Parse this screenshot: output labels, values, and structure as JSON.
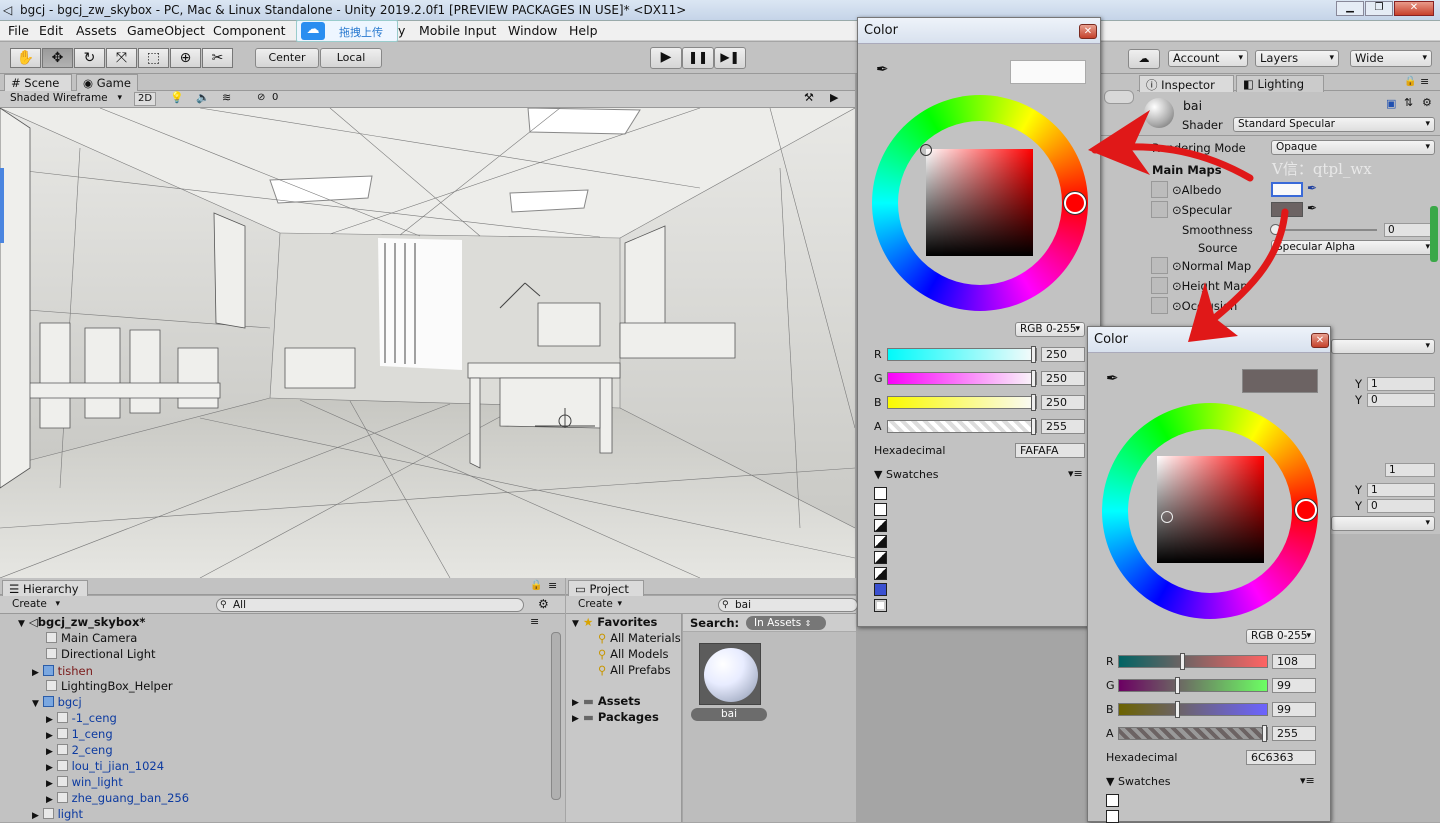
{
  "title": "bgcj - bgcj_zw_skybox - PC, Mac & Linux Standalone - Unity 2019.2.0f1 [PREVIEW PACKAGES IN USE]* <DX11>",
  "menu": [
    "File",
    "Edit",
    "Assets",
    "GameObject",
    "Component",
    "y",
    "Mobile Input",
    "Window",
    "Help"
  ],
  "upload_badge": "拖拽上传",
  "toolbar": {
    "center": "Center",
    "local": "Local",
    "account": "Account",
    "layers": "Layers",
    "layout": "Wide"
  },
  "scene": {
    "tab_scene": "Scene",
    "tab_game": "Game",
    "shading": "Shaded Wireframe",
    "mode2d": "2D",
    "hidden_count": "0"
  },
  "hierarchy": {
    "tab": "Hierarchy",
    "create": "Create",
    "search": "All",
    "items": [
      {
        "label": "bgcj_zw_skybox*"
      },
      {
        "label": "Main Camera"
      },
      {
        "label": "Directional Light"
      },
      {
        "label": "tishen"
      },
      {
        "label": "LightingBox_Helper"
      },
      {
        "label": "bgcj"
      },
      {
        "label": "-1_ceng"
      },
      {
        "label": "1_ceng"
      },
      {
        "label": "2_ceng"
      },
      {
        "label": "lou_ti_jian_1024"
      },
      {
        "label": "win_light"
      },
      {
        "label": "zhe_guang_ban_256"
      },
      {
        "label": "light"
      }
    ]
  },
  "project": {
    "tab": "Project",
    "create": "Create",
    "search": "bai",
    "search_label": "Search:",
    "search_scope": "In Assets",
    "favorites": "Favorites",
    "fav_items": [
      "All Materials",
      "All Models",
      "All Prefabs"
    ],
    "assets": "Assets",
    "packages": "Packages",
    "asset_name": "bai"
  },
  "inspector": {
    "tab": "Inspector",
    "tab_lighting": "Lighting",
    "name": "bai",
    "shader_label": "Shader",
    "shader": "Standard Specular",
    "rendering_mode_label": "Rendering Mode",
    "rendering_mode": "Opaque",
    "main_maps": "Main Maps",
    "albedo": "Albedo",
    "specular": "Specular",
    "smoothness": "Smoothness",
    "smoothness_value": "0",
    "source_label": "Source",
    "source": "Specular Alpha",
    "normal_map": "Normal Map",
    "height_map": "Height Map",
    "occlusion": "Occlusion",
    "y1": "Y",
    "y1v": "1",
    "y2": "Y",
    "y2v": "0",
    "tiling_extra": "1",
    "y3": "Y",
    "y3v": "1",
    "y4": "Y",
    "y4v": "0"
  },
  "watermark": "V信：qtpl_wx",
  "color1": {
    "title": "Color",
    "mode": "RGB 0-255",
    "r": "250",
    "g": "250",
    "b": "250",
    "a": "255",
    "hex_label": "Hexadecimal",
    "hex": "FAFAFA",
    "swatches": "Swatches",
    "swatch_color": "#fafafa"
  },
  "color2": {
    "title": "Color",
    "mode": "RGB 0-255",
    "r": "108",
    "g": "99",
    "b": "99",
    "a": "255",
    "hex_label": "Hexadecimal",
    "hex": "6C6363",
    "swatches": "Swatches",
    "swatch_color": "#6c6363"
  },
  "labels": {
    "r": "R",
    "g": "G",
    "b": "B",
    "a": "A"
  }
}
